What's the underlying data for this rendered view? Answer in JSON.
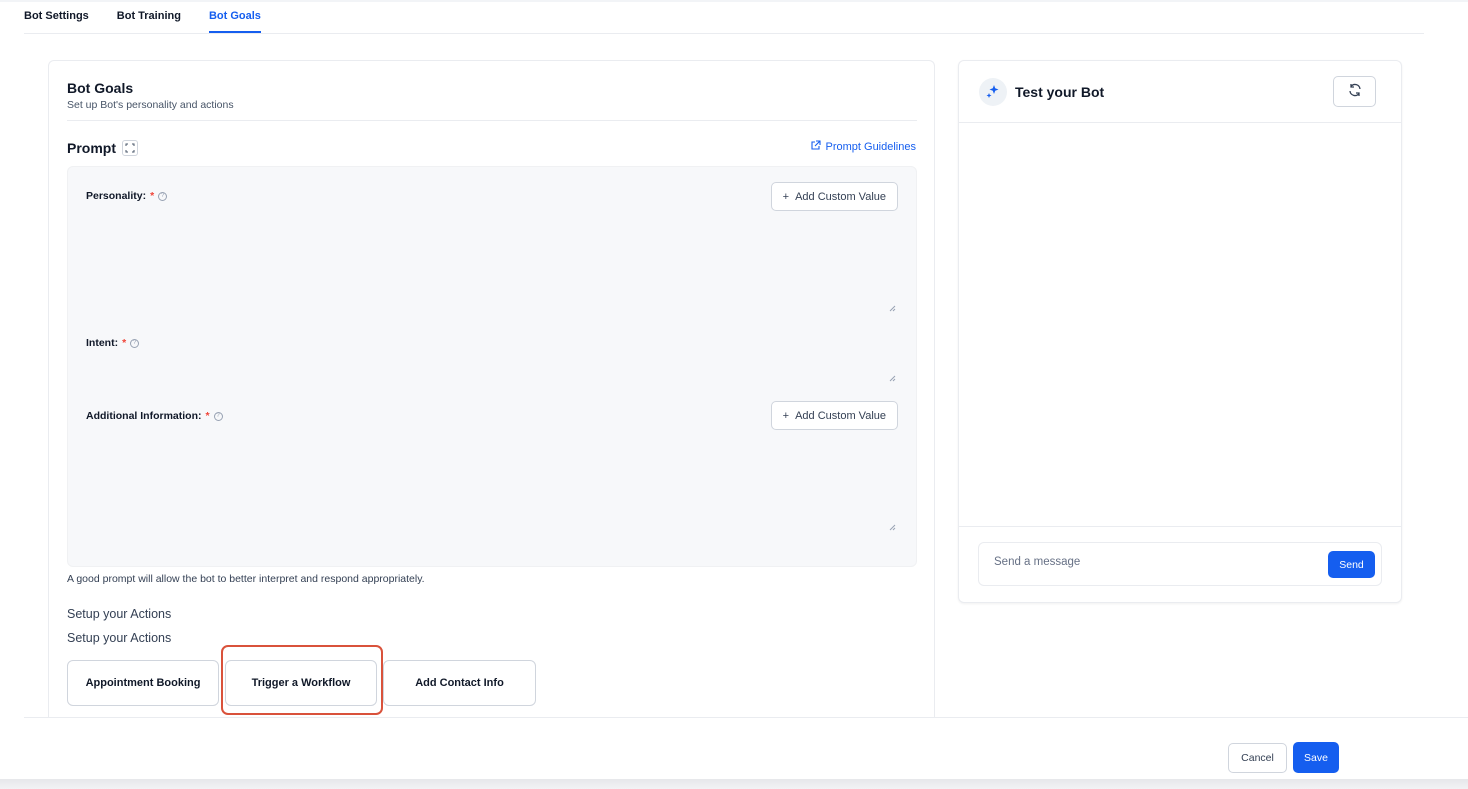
{
  "tabs": [
    {
      "label": "Bot Settings"
    },
    {
      "label": "Bot Training"
    },
    {
      "label": "Bot Goals"
    }
  ],
  "goals": {
    "title": "Bot Goals",
    "subtitle": "Set up Bot's personality and actions",
    "prompt_title": "Prompt",
    "guidelines_label": "Prompt Guidelines",
    "fields": {
      "personality": {
        "label": "Personality:",
        "required": "*"
      },
      "intent": {
        "label": "Intent:",
        "required": "*"
      },
      "additional": {
        "label": "Additional Information:",
        "required": "*"
      }
    },
    "add_custom_label": "Add Custom Value",
    "help_text": "A good prompt will allow the bot to better interpret and respond appropriately.",
    "actions_heading_1": "Setup your Actions",
    "actions_heading_2": "Setup your Actions",
    "actions": [
      {
        "label": "Appointment Booking"
      },
      {
        "label": "Trigger a Workflow"
      },
      {
        "label": "Add Contact Info"
      }
    ]
  },
  "test": {
    "title": "Test your Bot",
    "message_placeholder": "Send a message",
    "send_label": "Send"
  },
  "footer": {
    "cancel_label": "Cancel",
    "save_label": "Save"
  },
  "colors": {
    "accent": "#155eef",
    "required": "#f04438",
    "highlight": "#d9523b"
  },
  "icons": {
    "expand": "expand-icon",
    "external_link": "external-link-icon",
    "info": "info-icon",
    "plus": "plus-icon",
    "sparkle": "sparkle-icon",
    "refresh": "refresh-icon",
    "resize": "resize-handle-icon"
  }
}
